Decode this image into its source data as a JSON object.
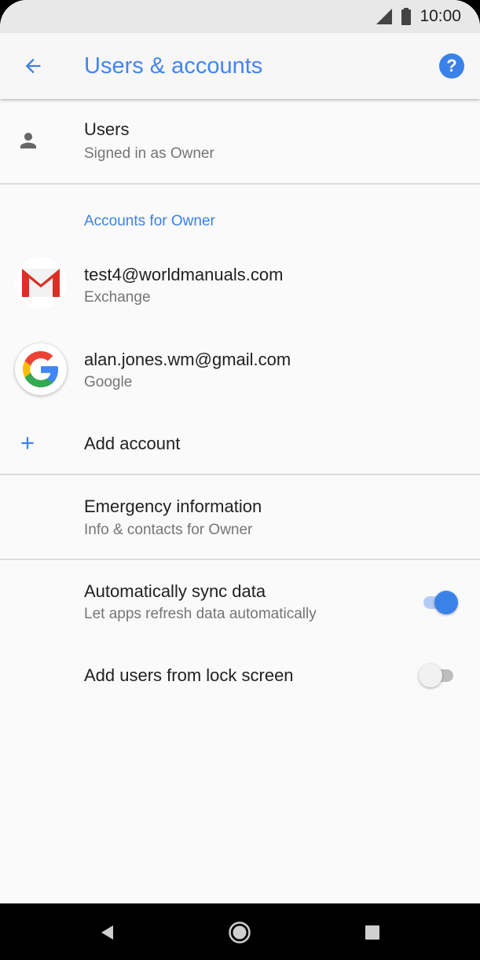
{
  "status_bar": {
    "time": "10:00"
  },
  "app_bar": {
    "title": "Users & accounts"
  },
  "users": {
    "title": "Users",
    "subtitle": "Signed in as Owner"
  },
  "accounts_section": {
    "header": "Accounts for Owner"
  },
  "accounts": [
    {
      "email": "test4@worldmanuals.com",
      "type": "Exchange",
      "icon": "gmail-icon"
    },
    {
      "email": "alan.jones.wm@gmail.com",
      "type": "Google",
      "icon": "google-icon"
    }
  ],
  "add_account": {
    "label": "Add account"
  },
  "emergency": {
    "title": "Emergency information",
    "subtitle": "Info & contacts for Owner"
  },
  "sync": {
    "title": "Automatically sync data",
    "subtitle": "Let apps refresh data automatically",
    "enabled": true
  },
  "lock_screen": {
    "title": "Add users from lock screen",
    "enabled": false
  },
  "colors": {
    "accent": "#4285f4",
    "toggle_on": "#3b82e8"
  }
}
